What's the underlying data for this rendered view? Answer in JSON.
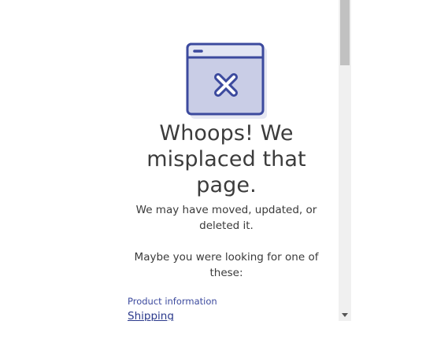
{
  "error": {
    "heading": "Whoops! We misplaced that page.",
    "message_line_1": "We may have moved, updated, or deleted it.",
    "message_line_2": "Maybe you were looking for one of these:"
  },
  "suggestions": {
    "section_label": "Product information",
    "links": [
      {
        "label": "Shipping"
      }
    ]
  },
  "icons": {
    "illustration": "browser-window-error-icon",
    "scroll_down": "chevron-down-icon"
  },
  "colors": {
    "accent": "#3c4a9e",
    "illustration_fill": "#c9cde6",
    "illustration_stroke": "#3c4a9e"
  },
  "scroll": {
    "position": 0
  }
}
